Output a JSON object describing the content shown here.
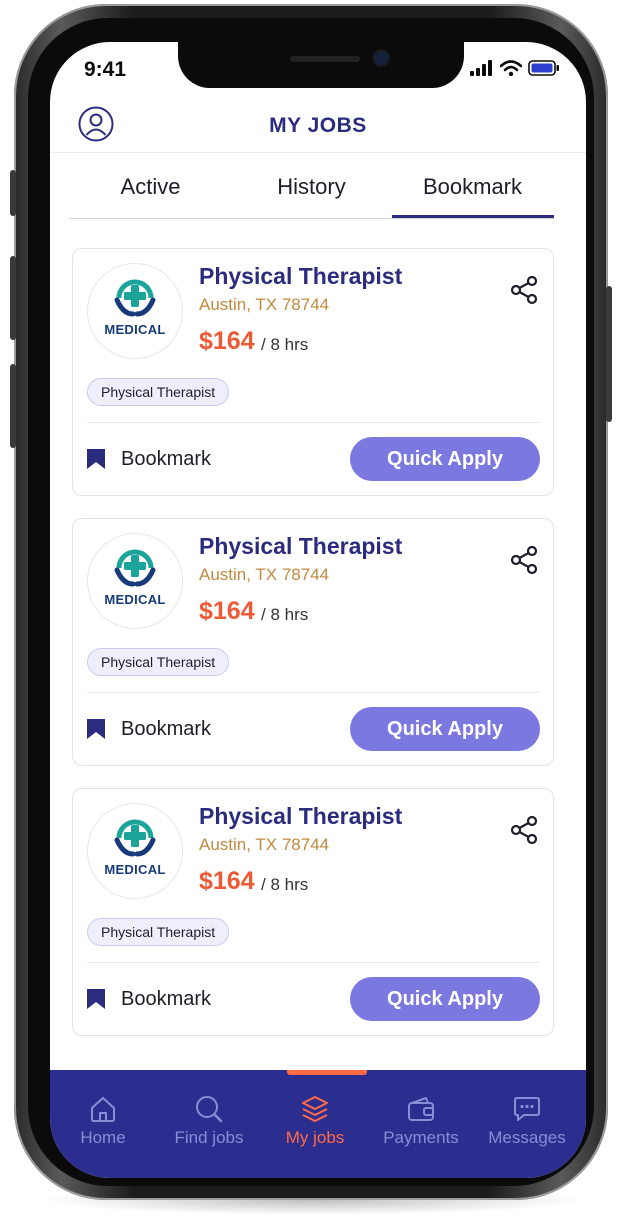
{
  "status_bar": {
    "time": "9:41"
  },
  "header": {
    "title": "MY JOBS",
    "profile_icon": "user-circle-icon"
  },
  "tabs": [
    {
      "label": "Active",
      "active": false
    },
    {
      "label": "History",
      "active": false
    },
    {
      "label": "Bookmark",
      "active": true
    }
  ],
  "jobs": [
    {
      "logo_text": "MEDICAL",
      "title": "Physical Therapist",
      "location": "Austin, TX 78744",
      "price": "$164",
      "duration": "/ 8 hrs",
      "tag": "Physical Therapist",
      "bookmark_label": "Bookmark",
      "apply_label": "Quick Apply"
    },
    {
      "logo_text": "MEDICAL",
      "title": "Physical Therapist",
      "location": "Austin, TX 78744",
      "price": "$164",
      "duration": "/ 8 hrs",
      "tag": "Physical Therapist",
      "bookmark_label": "Bookmark",
      "apply_label": "Quick Apply"
    },
    {
      "logo_text": "MEDICAL",
      "title": "Physical Therapist",
      "location": "Austin, TX 78744",
      "price": "$164",
      "duration": "/ 8 hrs",
      "tag": "Physical Therapist",
      "bookmark_label": "Bookmark",
      "apply_label": "Quick Apply"
    }
  ],
  "bottom_nav": [
    {
      "label": "Home",
      "icon": "home-icon",
      "active": false
    },
    {
      "label": "Find jobs",
      "icon": "search-icon",
      "active": false
    },
    {
      "label": "My jobs",
      "icon": "layers-icon",
      "active": true
    },
    {
      "label": "Payments",
      "icon": "wallet-icon",
      "active": false
    },
    {
      "label": "Messages",
      "icon": "chat-icon",
      "active": false
    }
  ],
  "colors": {
    "brand": "#2b2c7d",
    "accent": "#ee5a36",
    "button": "#7b79e0",
    "nav_bg": "#2c2e8f",
    "nav_active": "#ff6a45",
    "nav_inactive": "#8a8cd6"
  }
}
